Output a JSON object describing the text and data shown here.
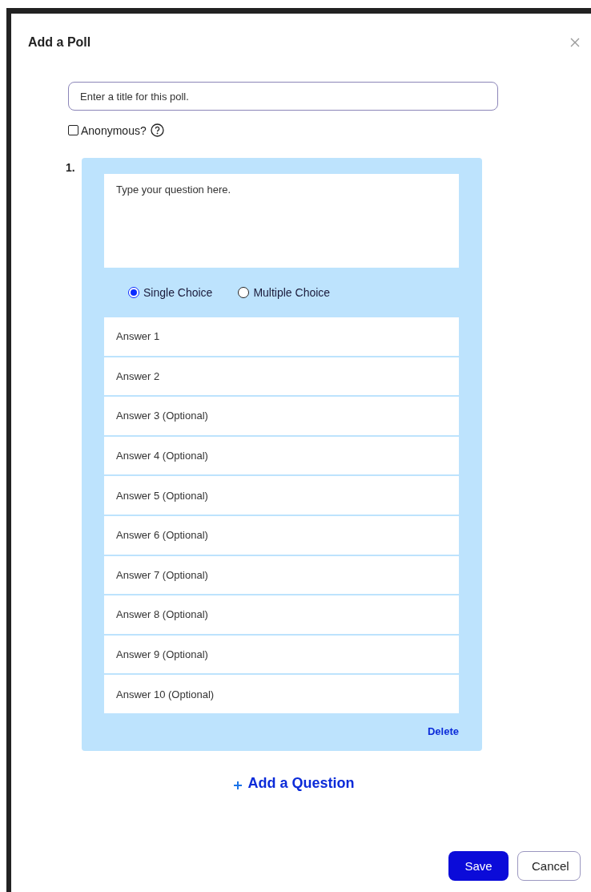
{
  "dialog": {
    "title": "Add a Poll"
  },
  "title_field": {
    "placeholder": "Enter a title for this poll."
  },
  "anonymous": {
    "label": "Anonymous?",
    "checked": false
  },
  "questions": [
    {
      "number": "1.",
      "placeholder": "Type your question here.",
      "choice_types": [
        {
          "label": "Single Choice",
          "selected": true
        },
        {
          "label": "Multiple Choice",
          "selected": false
        }
      ],
      "answers": [
        {
          "placeholder": "Answer 1"
        },
        {
          "placeholder": "Answer 2"
        },
        {
          "placeholder": "Answer 3 (Optional)"
        },
        {
          "placeholder": "Answer 4 (Optional)"
        },
        {
          "placeholder": "Answer 5 (Optional)"
        },
        {
          "placeholder": "Answer 6 (Optional)"
        },
        {
          "placeholder": "Answer 7 (Optional)"
        },
        {
          "placeholder": "Answer 8 (Optional)"
        },
        {
          "placeholder": "Answer 9 (Optional)"
        },
        {
          "placeholder": "Answer 10 (Optional)"
        }
      ],
      "delete": "Delete"
    }
  ],
  "add_question": "Add a Question",
  "buttons": [
    {
      "label": "Save",
      "kind": "primary"
    },
    {
      "label": "Cancel",
      "kind": "secondary"
    }
  ]
}
